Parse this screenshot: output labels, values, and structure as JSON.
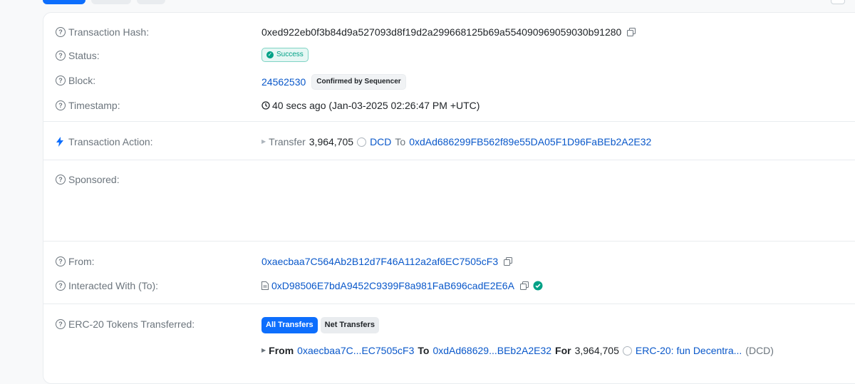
{
  "colors": {
    "accent": "#0d6efd",
    "link": "#0a58ca",
    "success": "#00a186",
    "label": "#6c757d"
  },
  "transaction": {
    "hash_label": "Transaction Hash:",
    "hash": "0xed922eb0f3b84d9a527093d8f19d2a299668125b69a554090969059030b91280",
    "status_label": "Status:",
    "status": "Success",
    "block_label": "Block:",
    "block": "24562530",
    "block_badge": "Confirmed by Sequencer",
    "timestamp_label": "Timestamp:",
    "timestamp": "40 secs ago (Jan-03-2025 02:26:47 PM +UTC)",
    "action_label": "Transaction Action:",
    "action": {
      "verb": "Transfer",
      "amount": "3,964,705",
      "token": "DCD",
      "to_word": "To",
      "to_address": "0xdAd686299FB562f89e55DA05F1D96FaBEb2A2E32"
    },
    "sponsored_label": "Sponsored:",
    "from_label": "From:",
    "from": "0xaecbaa7C564Ab2B12d7F46A112a2af6EC7505cF3",
    "interacted_label": "Interacted With (To):",
    "interacted": "0xD98506E7bdA9452C9399F8a981FaB696cadE2E6A",
    "erc20_label": "ERC-20 Tokens Transferred:",
    "erc20_tabs": {
      "all": "All Transfers",
      "net": "Net Transfers"
    },
    "erc20_transfer": {
      "from_word": "From",
      "from": "0xaecbaa7C...EC7505cF3",
      "to_word": "To",
      "to": "0xdAd68629...BEb2A2E32",
      "for_word": "For",
      "amount": "3,964,705",
      "token": "ERC-20: fun Decentra...",
      "symbol": "(DCD)"
    }
  },
  "icons": [
    "question-icon",
    "copy-icon",
    "clock-icon",
    "lightning-icon",
    "contract-file-icon",
    "verified-check-icon",
    "caret-right-icon",
    "token-icon"
  ]
}
